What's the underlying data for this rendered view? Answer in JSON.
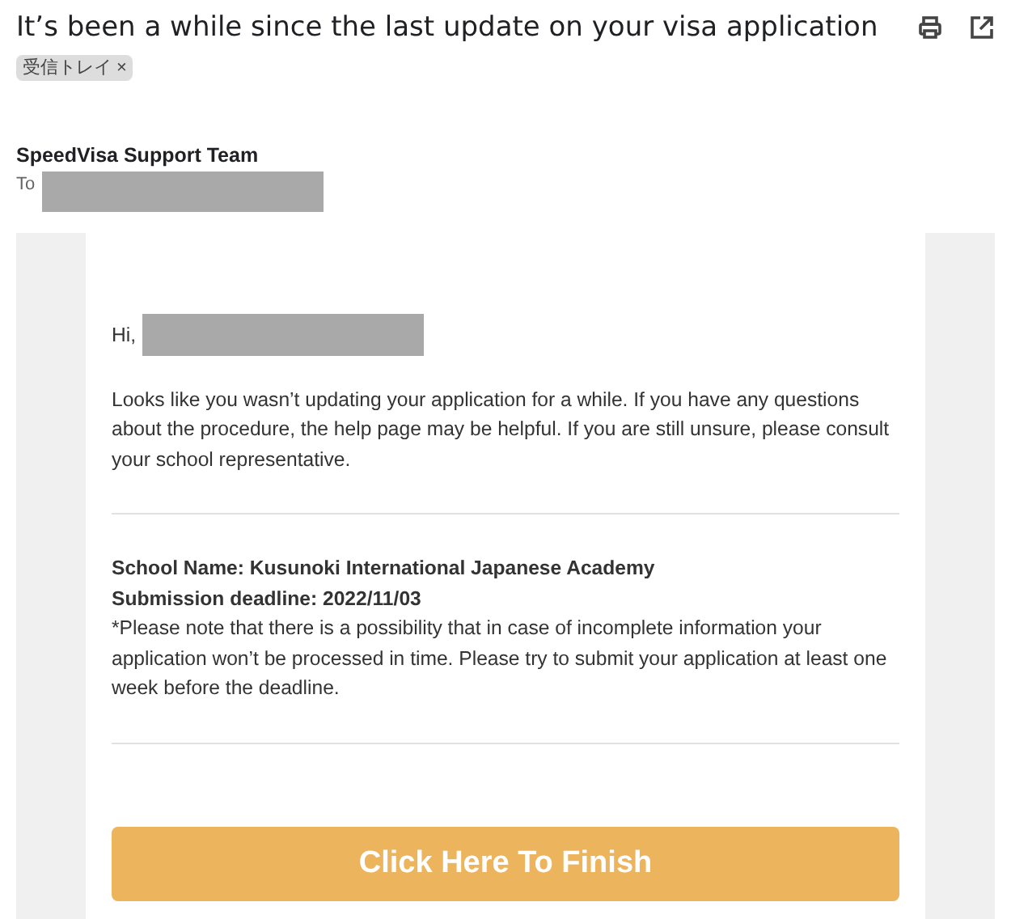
{
  "email": {
    "subject": "It’s been a while since the last update on your visa application",
    "labels": [
      {
        "text": "受信トレイ",
        "remove": "×"
      }
    ]
  },
  "sender": {
    "name": "SpeedVisa Support Team",
    "to_label": "To",
    "recipient_redacted": true
  },
  "body": {
    "greeting": "Hi,",
    "greeting_name_redacted": true,
    "intro": "Looks like you wasn’t updating your application for a while. If you have any questions about the procedure, the help page may be helpful. If you are still unsure, please consult your school representative.",
    "school_name": "School Name: Kusunoki International Japanese Academy",
    "deadline": "Submission deadline: 2022/11/03",
    "note": "*Please note that there is a possibility that in case of incomplete information your application won’t be processed in time. Please try to submit your application at least one week before the deadline.",
    "button": "Click Here To Finish"
  }
}
